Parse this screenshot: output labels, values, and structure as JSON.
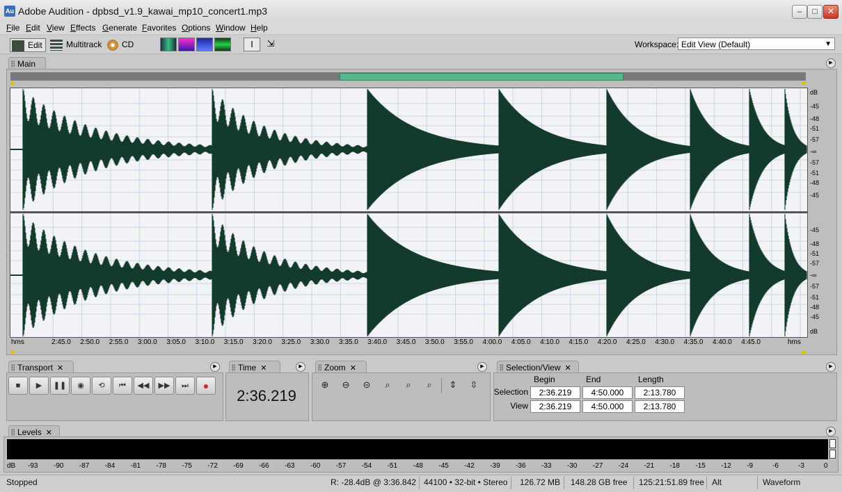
{
  "window": {
    "app_icon": "Au",
    "title": "Adobe Audition - dpbsd_v1.9_kawai_mp10_concert1.mp3"
  },
  "menu": [
    "File",
    "Edit",
    "View",
    "Effects",
    "Generate",
    "Favorites",
    "Options",
    "Window",
    "Help"
  ],
  "toolbar": {
    "edit_label": "Edit",
    "multitrack_label": "Multitrack",
    "cd_label": "CD",
    "workspace_label": "Workspace:",
    "workspace_value": "Edit View (Default)"
  },
  "main": {
    "tab_label": "Main",
    "db_labels_top": [
      "dB",
      "-45",
      "-48",
      "-51",
      "-57",
      "-∞",
      "-57",
      "-51",
      "-48",
      "-45"
    ],
    "db_labels_bottom": [
      "-45",
      "-48",
      "-51",
      "-57",
      "-∞",
      "-57",
      "-51",
      "-48",
      "-45",
      "dB"
    ],
    "time_ticks": [
      "hms",
      "2:45.0",
      "2:50.0",
      "2:55.0",
      "3:00.0",
      "3:05.0",
      "3:10.0",
      "3:15.0",
      "3:20.0",
      "3:25.0",
      "3:30.0",
      "3:35.0",
      "3:40.0",
      "3:45.0",
      "3:50.0",
      "3:55.0",
      "4:00.0",
      "4:05.0",
      "4:10.0",
      "4:15.0",
      "4:20.0",
      "4:25.0",
      "4:30.0",
      "4:35.0",
      "4:40.0",
      "4:45.0",
      "hms"
    ],
    "waveform_color": "#133a2b"
  },
  "transport": {
    "tab_label": "Transport"
  },
  "time_panel": {
    "tab_label": "Time",
    "value": "2:36.219"
  },
  "zoom": {
    "tab_label": "Zoom"
  },
  "selection_view": {
    "tab_label": "Selection/View",
    "headers": [
      "Begin",
      "End",
      "Length"
    ],
    "selection_label": "Selection",
    "view_label": "View",
    "selection": [
      "2:36.219",
      "4:50.000",
      "2:13.780"
    ],
    "view": [
      "2:36.219",
      "4:50.000",
      "2:13.780"
    ]
  },
  "levels": {
    "tab_label": "Levels",
    "ticks": [
      "dB",
      "-93",
      "-90",
      "-87",
      "-84",
      "-81",
      "-78",
      "-75",
      "-72",
      "-69",
      "-66",
      "-63",
      "-60",
      "-57",
      "-54",
      "-51",
      "-48",
      "-45",
      "-42",
      "-39",
      "-36",
      "-33",
      "-30",
      "-27",
      "-24",
      "-21",
      "-18",
      "-15",
      "-12",
      "-9",
      "-6",
      "-3",
      "0"
    ]
  },
  "status": {
    "state": "Stopped",
    "readout": "R: -28.4dB @  3:36.842",
    "format": "44100 • 32-bit • Stereo",
    "file_size": "126.72 MB",
    "disk_free": "148.28 GB free",
    "time_free": "125:21:51.89 free",
    "mode": "Alt",
    "view_mode": "Waveform"
  },
  "icons": {
    "close": "close-icon",
    "minimize": "minimize-icon",
    "maximize": "maximize-icon",
    "stop": "stop-icon",
    "play": "play-icon",
    "pause": "pause-icon",
    "record": "record-icon"
  },
  "colors": {
    "overview_thumb": "#54b88e",
    "waveform": "#133a2b",
    "record": "#d22a2a"
  }
}
